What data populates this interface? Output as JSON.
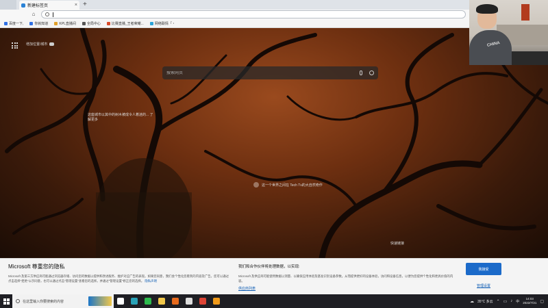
{
  "browser": {
    "tab_title": "新建标签页",
    "tab_close": "×",
    "new_tab": "+",
    "address_value": "",
    "bookmarks": [
      {
        "label": "百度一下,",
        "color": "#2f6fe3"
      },
      {
        "label": "你就知道",
        "color": "#2f6fe3"
      },
      {
        "label": "KPL直播间",
        "color": "#e0a02a"
      },
      {
        "label": "全局中心",
        "color": "#555555"
      },
      {
        "label": "比赛直播_王者荣耀...",
        "color": "#d84b2a"
      },
      {
        "label": "网络联情「・",
        "color": "#2aa3d8"
      }
    ]
  },
  "newtab_page": {
    "location_label": "增加位置/城市",
    "search_placeholder": "搜索网页",
    "hotspot_1": "这座城市以其中的树木被成令人着迷的... 了解更多",
    "hotspot_2": "这一个世界之间在 Tech Tv的大自然奇作",
    "quick_links_label": "快速链接"
  },
  "webcam": {
    "shirt_text": "CHINA"
  },
  "privacy_banner": {
    "title": "Microsoft 尊重您的隐私",
    "body": "Microsoft 及第三方供应商可能通过浏览器存储、访问您的数据以提供和改进服务、维护对应广告的表现。如果您同意，我们会个性化您看到的内容及广告。您可以通过点击选择\"拒绝\"以示同意，也可以通过点击\"管理设置\"查看您的选择。并通过\"管理设置\"修正您的选择。",
    "privacy_link": "隐私声明",
    "partner_title": "我们和合作伙伴将处理数据，以实现:",
    "partner_body": "Microsoft 及供应商可能使用数据以测量、以确保应用体验及基准识别设备参数。从而提供更好的设备体验，访问和设备信息，以便为您提供个性化和更具价值的内容。",
    "vendor_link": "供应商列表",
    "accept_button": "我接受",
    "manage_settings": "管理设置"
  },
  "taskbar": {
    "search_placeholder": "在这里输入你要搜索的内容",
    "weather": "35°C 多云",
    "ime": "中",
    "time": "14:03",
    "date": "2022/7/31",
    "apps": [
      {
        "name": "task-view",
        "color": "#ffffff"
      },
      {
        "name": "edge",
        "color": "#2aa3b8"
      },
      {
        "name": "wechat",
        "color": "#2dbb4e"
      },
      {
        "name": "file-explorer",
        "color": "#f2c84b"
      },
      {
        "name": "firefox",
        "color": "#e86b1e"
      },
      {
        "name": "video-player",
        "color": "#dddddd"
      },
      {
        "name": "chrome",
        "color": "#dd4435"
      },
      {
        "name": "mail",
        "color": "#f09a1a"
      }
    ]
  }
}
